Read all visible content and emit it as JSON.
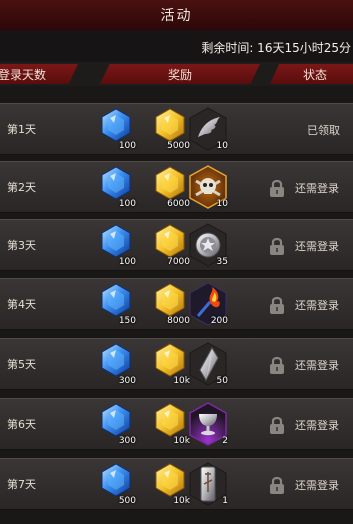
{
  "title": "活动",
  "timer": "剩余时间: 16天15小时25分",
  "headers": {
    "days": "登录天数",
    "reward": "奖励",
    "status": "状态"
  },
  "rows": [
    {
      "day": "第1天",
      "q1": "100",
      "q2": "5000",
      "q3": "10",
      "item3": "wing-icon",
      "status": "已领取"
    },
    {
      "day": "第2天",
      "q1": "100",
      "q2": "6000",
      "q3": "10",
      "item3": "skull-icon",
      "status": "还需登录"
    },
    {
      "day": "第3天",
      "q1": "100",
      "q2": "7000",
      "q3": "35",
      "item3": "silver-coin-icon",
      "status": "还需登录"
    },
    {
      "day": "第4天",
      "q1": "150",
      "q2": "8000",
      "q3": "200",
      "item3": "fire-torch-icon",
      "status": "还需登录"
    },
    {
      "day": "第5天",
      "q1": "300",
      "q2": "10k",
      "q3": "50",
      "item3": "crystal-shard-icon",
      "status": "还需登录"
    },
    {
      "day": "第6天",
      "q1": "300",
      "q2": "10k",
      "q3": "2",
      "item3": "chalice-icon",
      "status": "还需登录"
    },
    {
      "day": "第7天",
      "q1": "500",
      "q2": "10k",
      "q3": "1",
      "item3": "banner-icon",
      "status": "还需登录"
    }
  ]
}
